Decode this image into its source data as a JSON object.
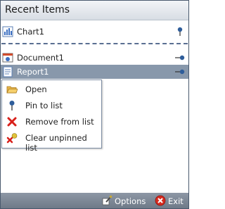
{
  "header": {
    "title": "Recent Items"
  },
  "pinned_items": [
    {
      "label": "Chart1",
      "icon": "chart-icon",
      "pinned": true
    }
  ],
  "recent_items": [
    {
      "label": "Document1",
      "icon": "document-icon",
      "pinned": false
    },
    {
      "label": "Report1",
      "icon": "report-icon",
      "pinned": false,
      "selected": true
    }
  ],
  "context_menu": {
    "items": [
      {
        "label": "Open",
        "icon": "folder-open-icon"
      },
      {
        "label": "Pin to list",
        "icon": "pin-icon"
      },
      {
        "label": "Remove from list",
        "icon": "remove-icon"
      },
      {
        "label": "Clear unpinned list",
        "icon": "clear-list-icon"
      }
    ]
  },
  "footer": {
    "options_label": "Options",
    "exit_label": "Exit"
  },
  "colors": {
    "selected_row": "#8898ab",
    "footer": "#7a8593",
    "separator": "#5a6f92"
  }
}
